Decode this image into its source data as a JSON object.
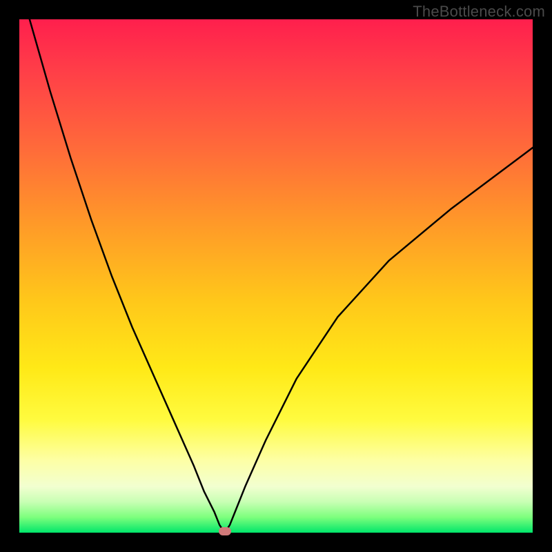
{
  "watermark": "TheBottleneck.com",
  "chart_data": {
    "type": "line",
    "title": "",
    "xlabel": "",
    "ylabel": "",
    "xlim": [
      0,
      100
    ],
    "ylim": [
      0,
      100
    ],
    "grid": false,
    "note": "Gradient heat background (red→yellow→green top→bottom) with a single black V-shaped curve. Axes are not labeled; values below are estimated from pixel positions as percentages of each axis.",
    "series": [
      {
        "name": "bottleneck-curve",
        "x": [
          2,
          6,
          10,
          14,
          18,
          22,
          26,
          30,
          34,
          36,
          38,
          39,
          40,
          41,
          42,
          44,
          48,
          54,
          62,
          72,
          84,
          96,
          100
        ],
        "y": [
          100,
          86,
          73,
          61,
          50,
          40,
          31,
          22,
          13,
          8,
          4,
          1.5,
          0,
          1.5,
          4,
          9,
          18,
          30,
          42,
          53,
          63,
          72,
          75
        ]
      }
    ],
    "marker": {
      "name": "optimal-point",
      "x_pct": 40,
      "y_pct": 0,
      "color": "#d17a7a"
    },
    "background_gradient": {
      "direction": "top-to-bottom",
      "stops": [
        {
          "pct": 0,
          "color": "#ff1f4d"
        },
        {
          "pct": 25,
          "color": "#ff6a3a"
        },
        {
          "pct": 55,
          "color": "#ffc81a"
        },
        {
          "pct": 78,
          "color": "#fffb3f"
        },
        {
          "pct": 94,
          "color": "#c8ffb4"
        },
        {
          "pct": 100,
          "color": "#00e66a"
        }
      ]
    }
  }
}
